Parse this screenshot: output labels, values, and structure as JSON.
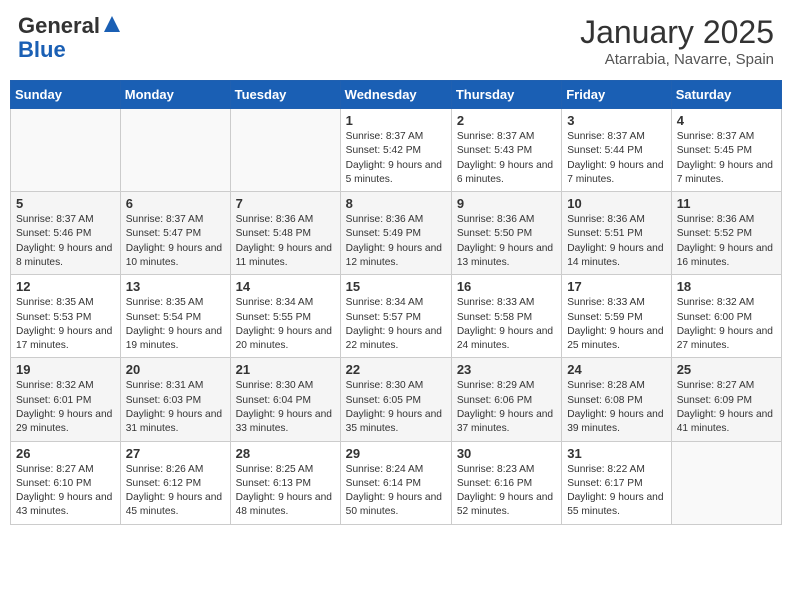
{
  "logo": {
    "general": "General",
    "blue": "Blue"
  },
  "title": "January 2025",
  "subtitle": "Atarrabia, Navarre, Spain",
  "weekdays": [
    "Sunday",
    "Monday",
    "Tuesday",
    "Wednesday",
    "Thursday",
    "Friday",
    "Saturday"
  ],
  "weeks": [
    [
      {
        "day": "",
        "detail": ""
      },
      {
        "day": "",
        "detail": ""
      },
      {
        "day": "",
        "detail": ""
      },
      {
        "day": "1",
        "detail": "Sunrise: 8:37 AM\nSunset: 5:42 PM\nDaylight: 9 hours and 5 minutes."
      },
      {
        "day": "2",
        "detail": "Sunrise: 8:37 AM\nSunset: 5:43 PM\nDaylight: 9 hours and 6 minutes."
      },
      {
        "day": "3",
        "detail": "Sunrise: 8:37 AM\nSunset: 5:44 PM\nDaylight: 9 hours and 7 minutes."
      },
      {
        "day": "4",
        "detail": "Sunrise: 8:37 AM\nSunset: 5:45 PM\nDaylight: 9 hours and 7 minutes."
      }
    ],
    [
      {
        "day": "5",
        "detail": "Sunrise: 8:37 AM\nSunset: 5:46 PM\nDaylight: 9 hours and 8 minutes."
      },
      {
        "day": "6",
        "detail": "Sunrise: 8:37 AM\nSunset: 5:47 PM\nDaylight: 9 hours and 10 minutes."
      },
      {
        "day": "7",
        "detail": "Sunrise: 8:36 AM\nSunset: 5:48 PM\nDaylight: 9 hours and 11 minutes."
      },
      {
        "day": "8",
        "detail": "Sunrise: 8:36 AM\nSunset: 5:49 PM\nDaylight: 9 hours and 12 minutes."
      },
      {
        "day": "9",
        "detail": "Sunrise: 8:36 AM\nSunset: 5:50 PM\nDaylight: 9 hours and 13 minutes."
      },
      {
        "day": "10",
        "detail": "Sunrise: 8:36 AM\nSunset: 5:51 PM\nDaylight: 9 hours and 14 minutes."
      },
      {
        "day": "11",
        "detail": "Sunrise: 8:36 AM\nSunset: 5:52 PM\nDaylight: 9 hours and 16 minutes."
      }
    ],
    [
      {
        "day": "12",
        "detail": "Sunrise: 8:35 AM\nSunset: 5:53 PM\nDaylight: 9 hours and 17 minutes."
      },
      {
        "day": "13",
        "detail": "Sunrise: 8:35 AM\nSunset: 5:54 PM\nDaylight: 9 hours and 19 minutes."
      },
      {
        "day": "14",
        "detail": "Sunrise: 8:34 AM\nSunset: 5:55 PM\nDaylight: 9 hours and 20 minutes."
      },
      {
        "day": "15",
        "detail": "Sunrise: 8:34 AM\nSunset: 5:57 PM\nDaylight: 9 hours and 22 minutes."
      },
      {
        "day": "16",
        "detail": "Sunrise: 8:33 AM\nSunset: 5:58 PM\nDaylight: 9 hours and 24 minutes."
      },
      {
        "day": "17",
        "detail": "Sunrise: 8:33 AM\nSunset: 5:59 PM\nDaylight: 9 hours and 25 minutes."
      },
      {
        "day": "18",
        "detail": "Sunrise: 8:32 AM\nSunset: 6:00 PM\nDaylight: 9 hours and 27 minutes."
      }
    ],
    [
      {
        "day": "19",
        "detail": "Sunrise: 8:32 AM\nSunset: 6:01 PM\nDaylight: 9 hours and 29 minutes."
      },
      {
        "day": "20",
        "detail": "Sunrise: 8:31 AM\nSunset: 6:03 PM\nDaylight: 9 hours and 31 minutes."
      },
      {
        "day": "21",
        "detail": "Sunrise: 8:30 AM\nSunset: 6:04 PM\nDaylight: 9 hours and 33 minutes."
      },
      {
        "day": "22",
        "detail": "Sunrise: 8:30 AM\nSunset: 6:05 PM\nDaylight: 9 hours and 35 minutes."
      },
      {
        "day": "23",
        "detail": "Sunrise: 8:29 AM\nSunset: 6:06 PM\nDaylight: 9 hours and 37 minutes."
      },
      {
        "day": "24",
        "detail": "Sunrise: 8:28 AM\nSunset: 6:08 PM\nDaylight: 9 hours and 39 minutes."
      },
      {
        "day": "25",
        "detail": "Sunrise: 8:27 AM\nSunset: 6:09 PM\nDaylight: 9 hours and 41 minutes."
      }
    ],
    [
      {
        "day": "26",
        "detail": "Sunrise: 8:27 AM\nSunset: 6:10 PM\nDaylight: 9 hours and 43 minutes."
      },
      {
        "day": "27",
        "detail": "Sunrise: 8:26 AM\nSunset: 6:12 PM\nDaylight: 9 hours and 45 minutes."
      },
      {
        "day": "28",
        "detail": "Sunrise: 8:25 AM\nSunset: 6:13 PM\nDaylight: 9 hours and 48 minutes."
      },
      {
        "day": "29",
        "detail": "Sunrise: 8:24 AM\nSunset: 6:14 PM\nDaylight: 9 hours and 50 minutes."
      },
      {
        "day": "30",
        "detail": "Sunrise: 8:23 AM\nSunset: 6:16 PM\nDaylight: 9 hours and 52 minutes."
      },
      {
        "day": "31",
        "detail": "Sunrise: 8:22 AM\nSunset: 6:17 PM\nDaylight: 9 hours and 55 minutes."
      },
      {
        "day": "",
        "detail": ""
      }
    ]
  ]
}
